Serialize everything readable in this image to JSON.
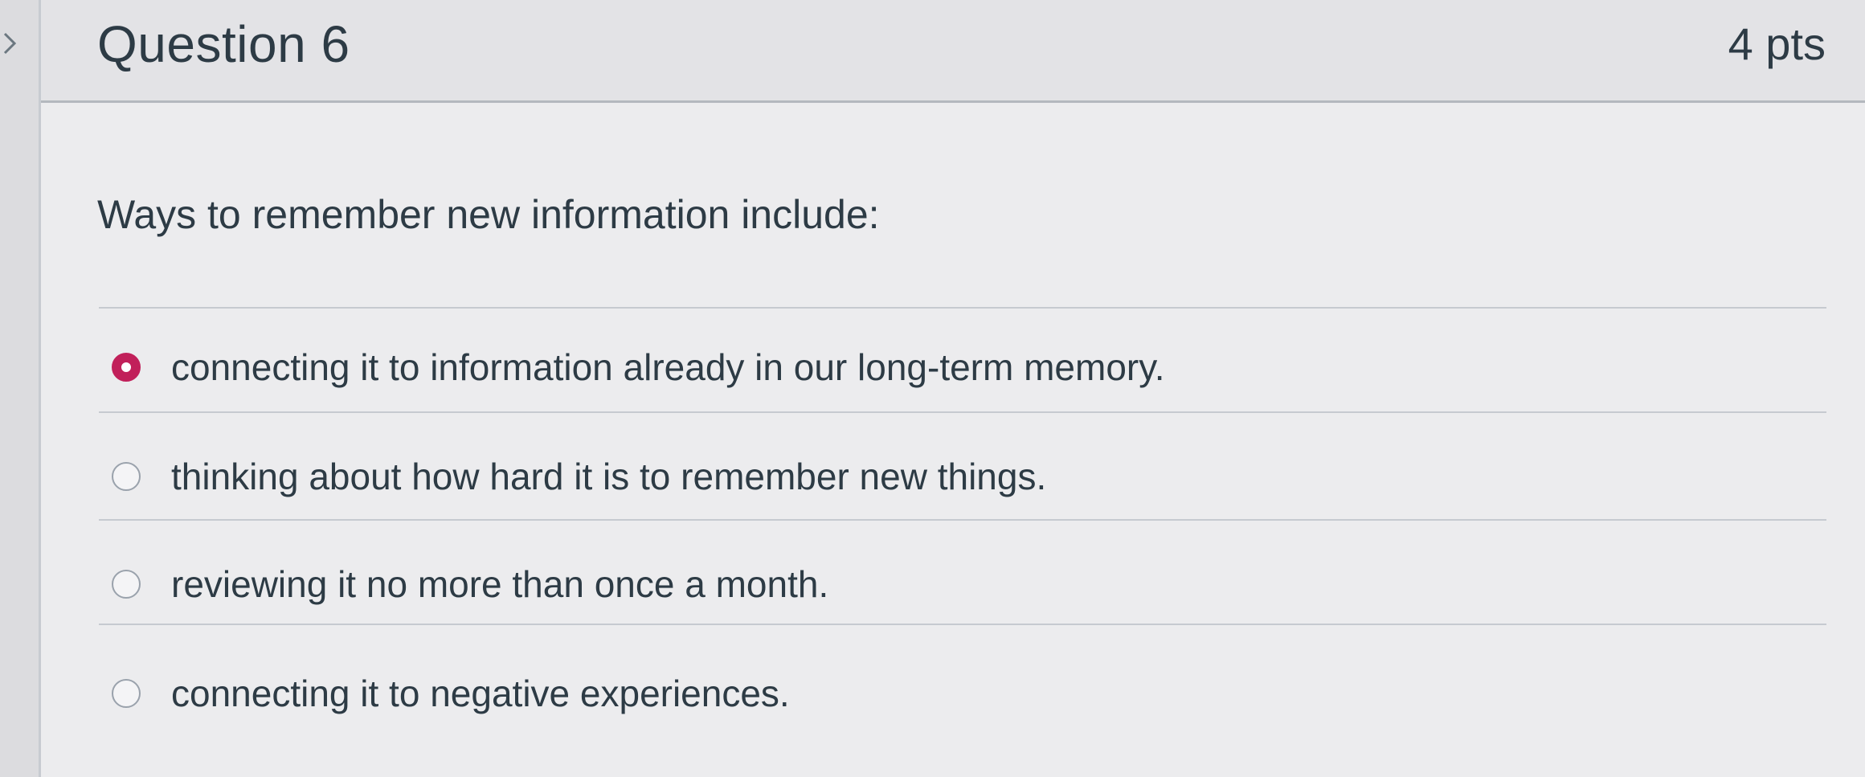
{
  "question": {
    "title": "Question 6",
    "points": "4 pts",
    "prompt": "Ways to remember new information include:",
    "selected_index": 0,
    "answers": [
      {
        "label": "connecting it to information already in our long-term memory.",
        "selected": true
      },
      {
        "label": "thinking about how hard it is to remember new things.",
        "selected": false
      },
      {
        "label": "reviewing it no more than once a month.",
        "selected": false
      },
      {
        "label": "connecting it to negative experiences.",
        "selected": false
      }
    ]
  },
  "colors": {
    "text": "#2d3b45",
    "selected_radio": "#c1205a",
    "divider": "#c6cad0"
  },
  "icons": {
    "nav": "chevron-right-icon",
    "selected": "radio-selected-icon",
    "unselected": "radio-unselected-icon"
  }
}
